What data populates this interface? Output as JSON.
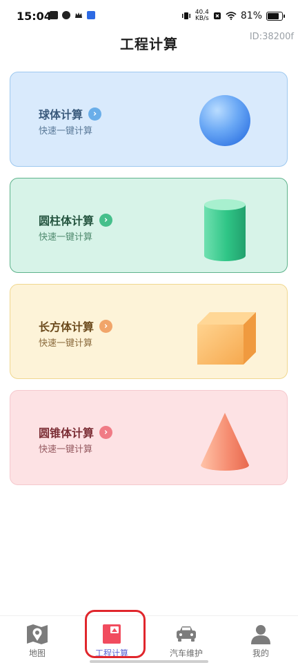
{
  "status_bar": {
    "time": "15:04",
    "net_speed_value": "40.4",
    "net_speed_unit": "KB/s",
    "battery": "81%"
  },
  "header": {
    "title": "工程计算",
    "id_tag": "ID:38200f"
  },
  "cards": [
    {
      "title": "球体计算",
      "subtitle": "快速一键计算",
      "icon": "sphere-icon",
      "accent": "#6aaee9"
    },
    {
      "title": "圆柱体计算",
      "subtitle": "快速一键计算",
      "icon": "cylinder-icon",
      "accent": "#45bf8b"
    },
    {
      "title": "长方体计算",
      "subtitle": "快速一键计算",
      "icon": "cuboid-icon",
      "accent": "#f1a56a"
    },
    {
      "title": "圆锥体计算",
      "subtitle": "快速一键计算",
      "icon": "cone-icon",
      "accent": "#f07b85"
    }
  ],
  "bottom_nav": [
    {
      "label": "地图",
      "icon": "map-icon",
      "active": false
    },
    {
      "label": "工程计算",
      "icon": "engineering-calc-icon",
      "active": true
    },
    {
      "label": "汽车维护",
      "icon": "car-icon",
      "active": false
    },
    {
      "label": "我的",
      "icon": "person-icon",
      "active": false
    }
  ]
}
